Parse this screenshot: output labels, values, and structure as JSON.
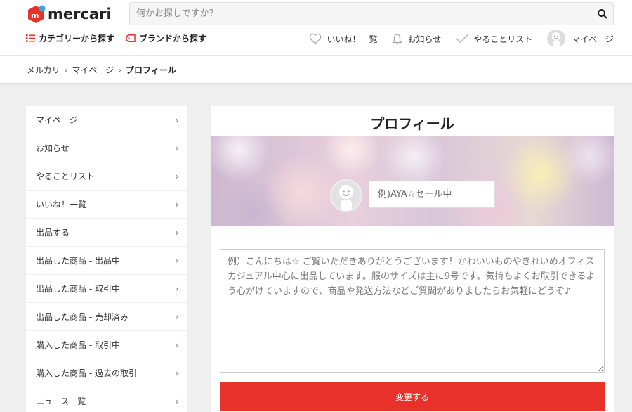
{
  "header": {
    "logo_text": "mercari",
    "search_placeholder": "何かお探しですか？",
    "nav_left": [
      {
        "label": "カテゴリーから探す",
        "icon": "list-icon"
      },
      {
        "label": "ブランドから探す",
        "icon": "tag-icon"
      }
    ],
    "nav_right": [
      {
        "label": "いいね！一覧",
        "icon": "heart-icon"
      },
      {
        "label": "お知らせ",
        "icon": "bell-icon"
      },
      {
        "label": "やることリスト",
        "icon": "check-icon"
      },
      {
        "label": "マイページ",
        "icon": "avatar"
      }
    ]
  },
  "breadcrumb": [
    "メルカリ",
    "マイページ",
    "プロフィール"
  ],
  "sidebar": {
    "items": [
      {
        "label": "マイページ"
      },
      {
        "label": "お知らせ"
      },
      {
        "label": "やることリスト"
      },
      {
        "label": "いいね！一覧"
      },
      {
        "label": "出品する"
      },
      {
        "label": "出品した商品 - 出品中"
      },
      {
        "label": "出品した商品 - 取引中"
      },
      {
        "label": "出品した商品 - 売却済み"
      },
      {
        "label": "購入した商品 - 取引中"
      },
      {
        "label": "購入した商品 - 過去の取引"
      },
      {
        "label": "ニュース一覧"
      }
    ]
  },
  "profile": {
    "title": "プロフィール",
    "nickname_placeholder": "例)AYA☆セール中",
    "bio_placeholder": "例）こんにちは☆ ご覧いただきありがとうございます！かわいいものやきれいめオフィスカジュアル中心に出品しています。服のサイズは主に9号です。気持ちよくお取引できるよう心がけていますので、商品や発送方法などご質問がありましたらお気軽にどうぞ♪",
    "submit_label": "変更する"
  },
  "colors": {
    "brand_red": "#e8312a",
    "logo_blue": "#3aa5e6"
  }
}
